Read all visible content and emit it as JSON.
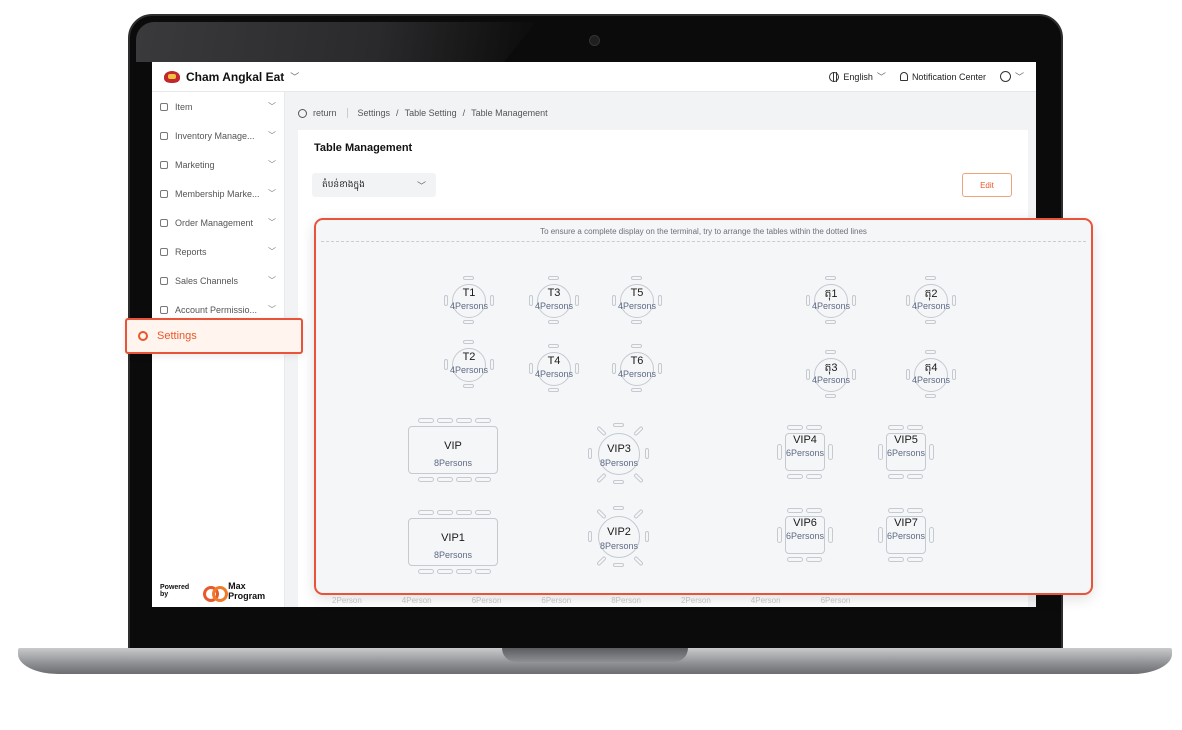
{
  "header": {
    "brand": "Cham Angkal Eat",
    "language": "English",
    "notifications": "Notification Center"
  },
  "sidebar": {
    "items": [
      {
        "label": "Item"
      },
      {
        "label": "Inventory Manage..."
      },
      {
        "label": "Marketing"
      },
      {
        "label": "Membership Marke..."
      },
      {
        "label": "Order Management"
      },
      {
        "label": "Reports"
      },
      {
        "label": "Sales Channels"
      },
      {
        "label": "Account Permissio..."
      }
    ],
    "active": "Settings",
    "powered_by": "Powered by",
    "powered_brand": "Max Program"
  },
  "breadcrumb": {
    "return": "return",
    "path1": "Settings",
    "path2": "Table Setting",
    "path3": "Table Management",
    "slash": "/"
  },
  "panel": {
    "title": "Table Management",
    "area_select": "តំបន់ខាងក្នុង",
    "edit_label": "Edit",
    "ghost": [
      "2Person",
      "4Person",
      "6Person",
      "6Person",
      "8Person",
      "2Person",
      "4Person",
      "6Person"
    ]
  },
  "floor": {
    "hint": "To ensure a complete display on the terminal, try to arrange the tables within the dotted lines",
    "tables": [
      {
        "name": "T1",
        "cap": "4Persons"
      },
      {
        "name": "T3",
        "cap": "4Persons"
      },
      {
        "name": "T5",
        "cap": "4Persons"
      },
      {
        "name": "តុ1",
        "cap": "4Persons"
      },
      {
        "name": "តុ2",
        "cap": "4Persons"
      },
      {
        "name": "T2",
        "cap": "4Persons"
      },
      {
        "name": "T4",
        "cap": "4Persons"
      },
      {
        "name": "T6",
        "cap": "4Persons"
      },
      {
        "name": "តុ3",
        "cap": "4Persons"
      },
      {
        "name": "តុ4",
        "cap": "4Persons"
      },
      {
        "name": "VIP",
        "cap": "8Persons"
      },
      {
        "name": "VIP3",
        "cap": "8Persons"
      },
      {
        "name": "VIP4",
        "cap": "6Persons"
      },
      {
        "name": "VIP5",
        "cap": "6Persons"
      },
      {
        "name": "VIP1",
        "cap": "8Persons"
      },
      {
        "name": "VIP2",
        "cap": "8Persons"
      },
      {
        "name": "VIP6",
        "cap": "6Persons"
      },
      {
        "name": "VIP7",
        "cap": "6Persons"
      }
    ]
  },
  "colors": {
    "accent": "#e8582a",
    "highlight_border": "#e8533a",
    "capacity_text": "#5e6a85"
  }
}
